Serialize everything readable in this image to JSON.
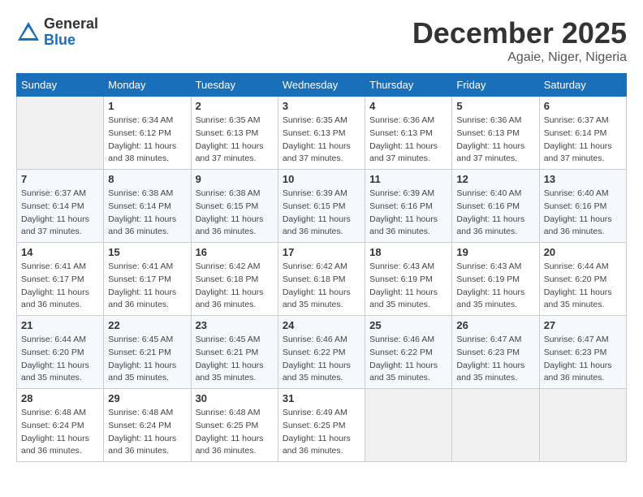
{
  "app": {
    "logo_general": "General",
    "logo_blue": "Blue"
  },
  "header": {
    "month": "December 2025",
    "location": "Agaie, Niger, Nigeria"
  },
  "weekdays": [
    "Sunday",
    "Monday",
    "Tuesday",
    "Wednesday",
    "Thursday",
    "Friday",
    "Saturday"
  ],
  "weeks": [
    [
      {
        "day": "",
        "sunrise": "",
        "sunset": "",
        "daylight": "",
        "empty": true
      },
      {
        "day": "1",
        "sunrise": "Sunrise: 6:34 AM",
        "sunset": "Sunset: 6:12 PM",
        "daylight": "Daylight: 11 hours and 38 minutes."
      },
      {
        "day": "2",
        "sunrise": "Sunrise: 6:35 AM",
        "sunset": "Sunset: 6:13 PM",
        "daylight": "Daylight: 11 hours and 37 minutes."
      },
      {
        "day": "3",
        "sunrise": "Sunrise: 6:35 AM",
        "sunset": "Sunset: 6:13 PM",
        "daylight": "Daylight: 11 hours and 37 minutes."
      },
      {
        "day": "4",
        "sunrise": "Sunrise: 6:36 AM",
        "sunset": "Sunset: 6:13 PM",
        "daylight": "Daylight: 11 hours and 37 minutes."
      },
      {
        "day": "5",
        "sunrise": "Sunrise: 6:36 AM",
        "sunset": "Sunset: 6:13 PM",
        "daylight": "Daylight: 11 hours and 37 minutes."
      },
      {
        "day": "6",
        "sunrise": "Sunrise: 6:37 AM",
        "sunset": "Sunset: 6:14 PM",
        "daylight": "Daylight: 11 hours and 37 minutes."
      }
    ],
    [
      {
        "day": "7",
        "sunrise": "Sunrise: 6:37 AM",
        "sunset": "Sunset: 6:14 PM",
        "daylight": "Daylight: 11 hours and 37 minutes."
      },
      {
        "day": "8",
        "sunrise": "Sunrise: 6:38 AM",
        "sunset": "Sunset: 6:14 PM",
        "daylight": "Daylight: 11 hours and 36 minutes."
      },
      {
        "day": "9",
        "sunrise": "Sunrise: 6:38 AM",
        "sunset": "Sunset: 6:15 PM",
        "daylight": "Daylight: 11 hours and 36 minutes."
      },
      {
        "day": "10",
        "sunrise": "Sunrise: 6:39 AM",
        "sunset": "Sunset: 6:15 PM",
        "daylight": "Daylight: 11 hours and 36 minutes."
      },
      {
        "day": "11",
        "sunrise": "Sunrise: 6:39 AM",
        "sunset": "Sunset: 6:16 PM",
        "daylight": "Daylight: 11 hours and 36 minutes."
      },
      {
        "day": "12",
        "sunrise": "Sunrise: 6:40 AM",
        "sunset": "Sunset: 6:16 PM",
        "daylight": "Daylight: 11 hours and 36 minutes."
      },
      {
        "day": "13",
        "sunrise": "Sunrise: 6:40 AM",
        "sunset": "Sunset: 6:16 PM",
        "daylight": "Daylight: 11 hours and 36 minutes."
      }
    ],
    [
      {
        "day": "14",
        "sunrise": "Sunrise: 6:41 AM",
        "sunset": "Sunset: 6:17 PM",
        "daylight": "Daylight: 11 hours and 36 minutes."
      },
      {
        "day": "15",
        "sunrise": "Sunrise: 6:41 AM",
        "sunset": "Sunset: 6:17 PM",
        "daylight": "Daylight: 11 hours and 36 minutes."
      },
      {
        "day": "16",
        "sunrise": "Sunrise: 6:42 AM",
        "sunset": "Sunset: 6:18 PM",
        "daylight": "Daylight: 11 hours and 36 minutes."
      },
      {
        "day": "17",
        "sunrise": "Sunrise: 6:42 AM",
        "sunset": "Sunset: 6:18 PM",
        "daylight": "Daylight: 11 hours and 35 minutes."
      },
      {
        "day": "18",
        "sunrise": "Sunrise: 6:43 AM",
        "sunset": "Sunset: 6:19 PM",
        "daylight": "Daylight: 11 hours and 35 minutes."
      },
      {
        "day": "19",
        "sunrise": "Sunrise: 6:43 AM",
        "sunset": "Sunset: 6:19 PM",
        "daylight": "Daylight: 11 hours and 35 minutes."
      },
      {
        "day": "20",
        "sunrise": "Sunrise: 6:44 AM",
        "sunset": "Sunset: 6:20 PM",
        "daylight": "Daylight: 11 hours and 35 minutes."
      }
    ],
    [
      {
        "day": "21",
        "sunrise": "Sunrise: 6:44 AM",
        "sunset": "Sunset: 6:20 PM",
        "daylight": "Daylight: 11 hours and 35 minutes."
      },
      {
        "day": "22",
        "sunrise": "Sunrise: 6:45 AM",
        "sunset": "Sunset: 6:21 PM",
        "daylight": "Daylight: 11 hours and 35 minutes."
      },
      {
        "day": "23",
        "sunrise": "Sunrise: 6:45 AM",
        "sunset": "Sunset: 6:21 PM",
        "daylight": "Daylight: 11 hours and 35 minutes."
      },
      {
        "day": "24",
        "sunrise": "Sunrise: 6:46 AM",
        "sunset": "Sunset: 6:22 PM",
        "daylight": "Daylight: 11 hours and 35 minutes."
      },
      {
        "day": "25",
        "sunrise": "Sunrise: 6:46 AM",
        "sunset": "Sunset: 6:22 PM",
        "daylight": "Daylight: 11 hours and 35 minutes."
      },
      {
        "day": "26",
        "sunrise": "Sunrise: 6:47 AM",
        "sunset": "Sunset: 6:23 PM",
        "daylight": "Daylight: 11 hours and 35 minutes."
      },
      {
        "day": "27",
        "sunrise": "Sunrise: 6:47 AM",
        "sunset": "Sunset: 6:23 PM",
        "daylight": "Daylight: 11 hours and 36 minutes."
      }
    ],
    [
      {
        "day": "28",
        "sunrise": "Sunrise: 6:48 AM",
        "sunset": "Sunset: 6:24 PM",
        "daylight": "Daylight: 11 hours and 36 minutes."
      },
      {
        "day": "29",
        "sunrise": "Sunrise: 6:48 AM",
        "sunset": "Sunset: 6:24 PM",
        "daylight": "Daylight: 11 hours and 36 minutes."
      },
      {
        "day": "30",
        "sunrise": "Sunrise: 6:48 AM",
        "sunset": "Sunset: 6:25 PM",
        "daylight": "Daylight: 11 hours and 36 minutes."
      },
      {
        "day": "31",
        "sunrise": "Sunrise: 6:49 AM",
        "sunset": "Sunset: 6:25 PM",
        "daylight": "Daylight: 11 hours and 36 minutes."
      },
      {
        "day": "",
        "sunrise": "",
        "sunset": "",
        "daylight": "",
        "empty": true
      },
      {
        "day": "",
        "sunrise": "",
        "sunset": "",
        "daylight": "",
        "empty": true
      },
      {
        "day": "",
        "sunrise": "",
        "sunset": "",
        "daylight": "",
        "empty": true
      }
    ]
  ]
}
